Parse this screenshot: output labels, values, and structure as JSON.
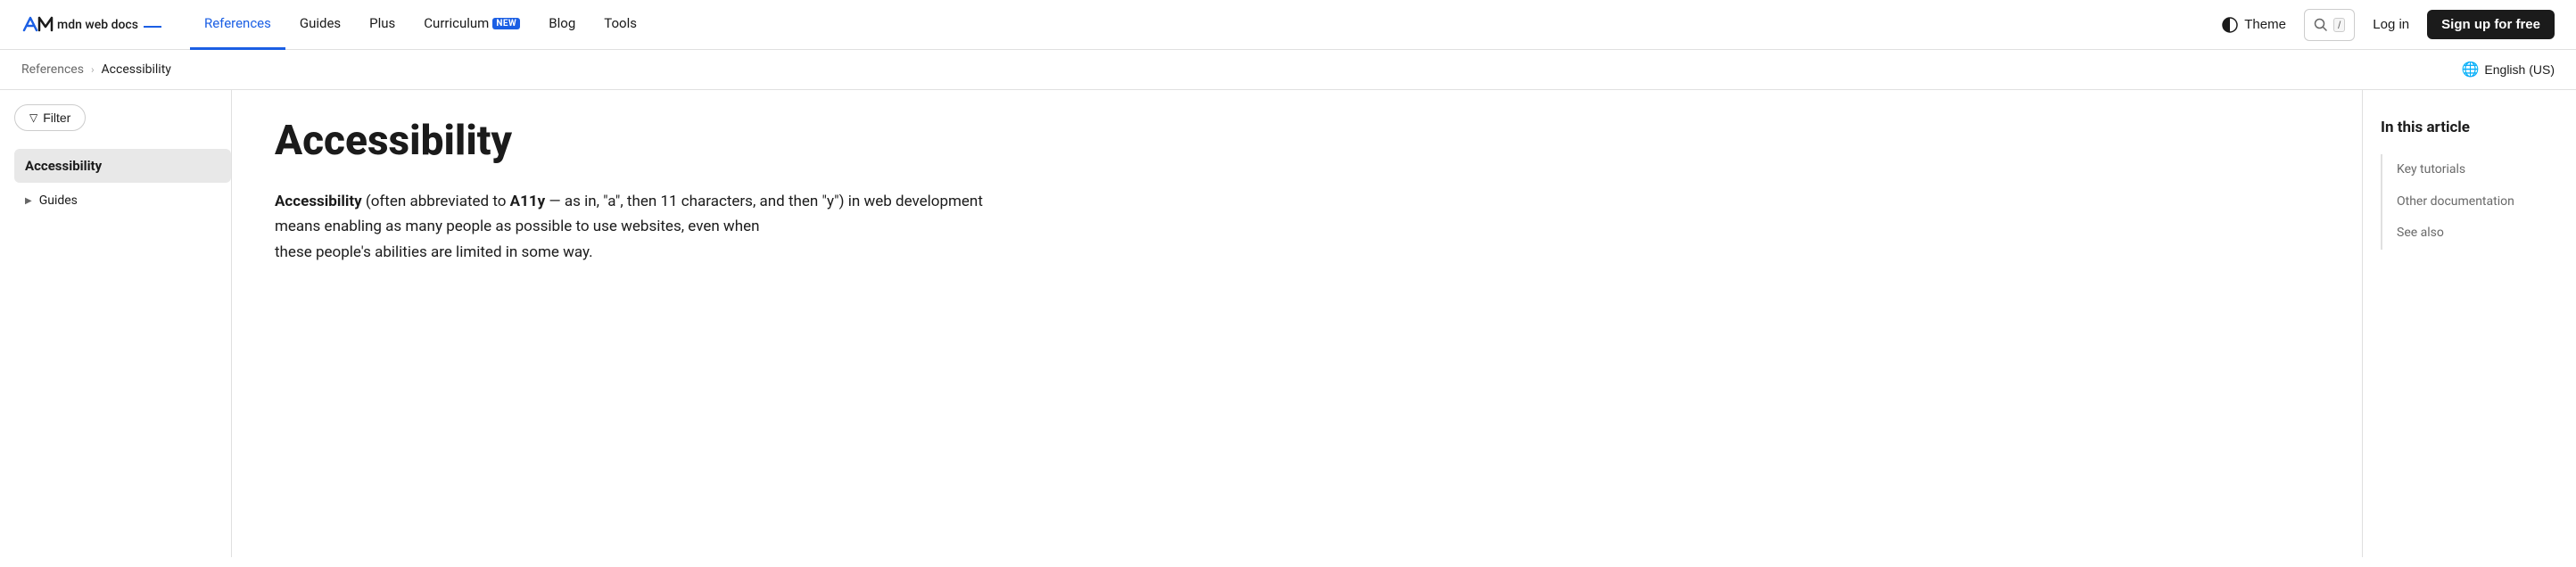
{
  "nav": {
    "logo_text": "mdn web docs",
    "links": [
      {
        "label": "References",
        "active": true
      },
      {
        "label": "Guides",
        "active": false
      },
      {
        "label": "Plus",
        "active": false
      },
      {
        "label": "Curriculum",
        "active": false,
        "badge": "NEW"
      },
      {
        "label": "Blog",
        "active": false
      },
      {
        "label": "Tools",
        "active": false
      }
    ],
    "theme_label": "Theme",
    "search_shortcut": "/",
    "login_label": "Log in",
    "signup_label": "Sign up for free"
  },
  "breadcrumb": {
    "items": [
      {
        "label": "References",
        "href": "#"
      },
      {
        "label": "Accessibility"
      }
    ],
    "separator": "›",
    "lang_label": "English (US)"
  },
  "sidebar": {
    "filter_label": "Filter",
    "section_title": "Accessibility",
    "items": [
      {
        "label": "Guides",
        "has_chevron": true
      }
    ]
  },
  "main": {
    "title": "Accessibility",
    "intro_bold1": "Accessibility",
    "intro_text1": " (often abbreviated to ",
    "intro_bold2": "A11y",
    "intro_text2": " — as in, \"a\", then 11 characters, and then \"y\") in web development means enabling as many people as possible to use websites, even when",
    "intro_text3": "these people's abilities are limited in some way."
  },
  "toc": {
    "title": "In this article",
    "items": [
      {
        "label": "Key tutorials"
      },
      {
        "label": "Other documentation"
      },
      {
        "label": "See also"
      }
    ]
  }
}
